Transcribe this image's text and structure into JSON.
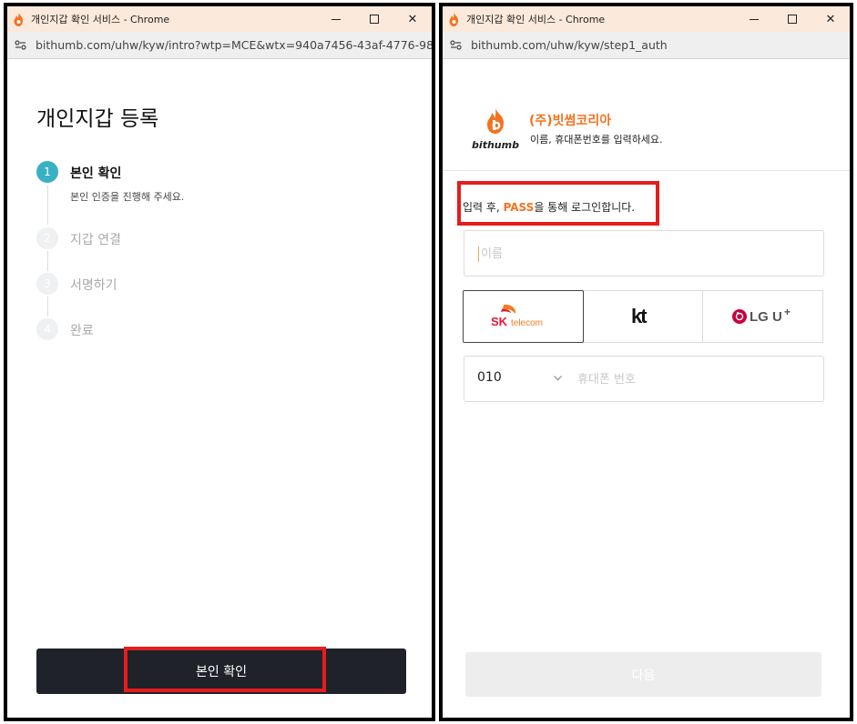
{
  "left_window": {
    "title": "개인지갑 확인 서비스 - Chrome",
    "url": "bithumb.com/uhw/kyw/intro?wtp=MCE&wtx=940a7456-43af-4776-98...",
    "page_title": "개인지갑 등록",
    "steps": [
      {
        "number": "1",
        "label": "본인 확인",
        "description": "본인 인증을 진행해 주세요.",
        "state": "active"
      },
      {
        "number": "2",
        "label": "지갑 연결",
        "state": "inactive"
      },
      {
        "number": "3",
        "label": "서명하기",
        "state": "inactive"
      },
      {
        "number": "4",
        "label": "완료",
        "state": "inactive"
      }
    ],
    "confirm_button": "본인 확인"
  },
  "right_window": {
    "title": "개인지갑 확인 서비스 - Chrome",
    "url": "bithumb.com/uhw/kyw/step1_auth",
    "brand_wordmark": "bithumb",
    "company_name": "(주)빗썸코리아",
    "company_desc": "이름, 휴대폰번호를 입력하세요.",
    "guide_prefix": "입력 후, ",
    "guide_pass": "PASS",
    "guide_suffix": "을 통해 로그인합니다.",
    "name_placeholder": "이름",
    "carriers": [
      {
        "name": "SK telecom",
        "brand_text": "SK",
        "sub_text": "telecom",
        "selected": true
      },
      {
        "name": "kt",
        "brand_text": "kt",
        "selected": false
      },
      {
        "name": "LG U+",
        "brand_text": "LG U",
        "sup_text": "+",
        "selected": false
      }
    ],
    "carrier_code": "010",
    "phone_placeholder": "휴대폰 번호",
    "next_button": "다음"
  },
  "colors": {
    "accent_orange": "#f37321",
    "step_active": "#3ab0c3",
    "primary_button": "#1f2329",
    "highlight_red": "#e51c1c",
    "titlebar": "#fbe9dc"
  },
  "icons": {
    "browser_logo": "bithumb-flame-icon",
    "site_info": "tune-icon",
    "dropdown": "chevron-down-icon"
  }
}
